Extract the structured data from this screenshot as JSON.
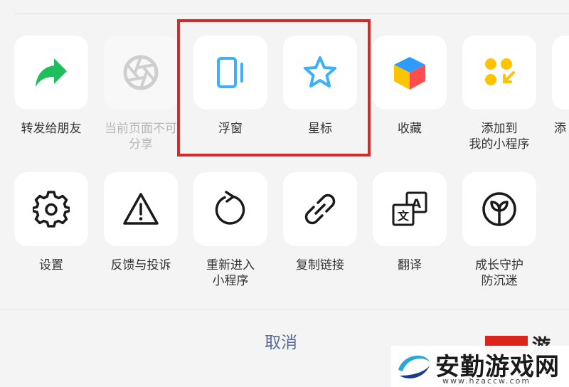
{
  "share_row": [
    {
      "label": "转发给朋友",
      "icon": "forward-arrow-icon",
      "disabled": false
    },
    {
      "label": "当前页面不可\n分享",
      "icon": "aperture-icon",
      "disabled": true
    },
    {
      "label": "浮窗",
      "icon": "floating-window-icon",
      "disabled": false
    },
    {
      "label": "星标",
      "icon": "star-icon",
      "disabled": false
    },
    {
      "label": "收藏",
      "icon": "cube-icon",
      "disabled": false
    },
    {
      "label": "添加到\n我的小程序",
      "icon": "add-mini-program-icon",
      "disabled": false
    }
  ],
  "share_row_partial_label": "添",
  "action_row": [
    {
      "label": "设置",
      "icon": "gear-icon"
    },
    {
      "label": "反馈与投诉",
      "icon": "warning-icon"
    },
    {
      "label": "重新进入\n小程序",
      "icon": "reload-icon"
    },
    {
      "label": "复制链接",
      "icon": "link-icon"
    },
    {
      "label": "翻译",
      "icon": "translate-icon"
    },
    {
      "label": "成长守护\n防沉迷",
      "icon": "sprout-icon"
    }
  ],
  "translate_icon_glyphs": {
    "front": "文",
    "back": "A"
  },
  "cancel_label": "取消",
  "watermark": {
    "title": "安勤游戏网",
    "url": "www.hzaccw.com",
    "partial_text": "游"
  },
  "colors": {
    "forward": "#1dbf5a",
    "disabled_icon": "#cfcfcf",
    "floating": "#3ab0ff",
    "star": "#3ab0ff",
    "cube_top": "#2f9bff",
    "cube_left": "#ffc400",
    "cube_right": "#ff4d4f",
    "mini_program": "#ffc300",
    "cancel": "#576b95",
    "highlight": "#d62a2a"
  }
}
